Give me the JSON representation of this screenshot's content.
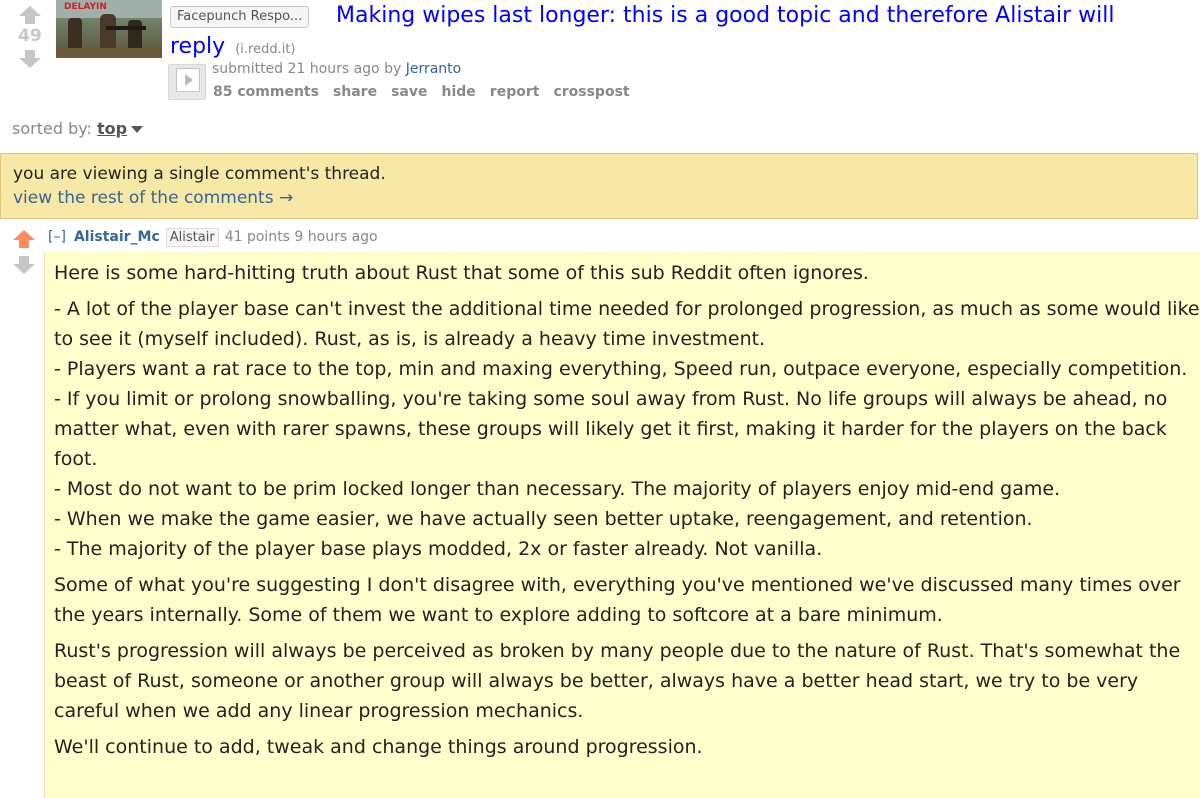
{
  "post": {
    "score": "49",
    "flair": "Facepunch Respo...",
    "title": "Making wipes last longer: this is a good topic and therefore Alistair will reply",
    "domain": "(i.redd.it)",
    "thumbnail_text": "DELAYIN",
    "submitted_prefix": "submitted 21 hours ago by",
    "author": "Jerranto",
    "buttons": {
      "comments": "85 comments",
      "share": "share",
      "save": "save",
      "hide": "hide",
      "report": "report",
      "crosspost": "crosspost"
    }
  },
  "sort": {
    "label": "sorted by:",
    "value": "top"
  },
  "notice": {
    "line1": "you are viewing a single comment's thread.",
    "line2": "view the rest of the comments →"
  },
  "comment": {
    "expand": "[–]",
    "author": "Alistair_Mc",
    "flair": "Alistair",
    "meta": "41 points 9 hours ago",
    "intro": "Here is some hard-hitting truth about Rust that some of this sub Reddit often ignores.",
    "bullets": [
      "- A lot of the player base can't invest the additional time needed for prolonged progression, as much as some would like to see it (myself included). Rust, as is, is already a heavy time investment.",
      "- Players want a rat race to the top, min and maxing everything, Speed run, outpace everyone, especially competition.",
      "- If you limit or prolong snowballing, you're taking some soul away from Rust. No life groups will always be ahead, no matter what, even with rarer spawns, these groups will likely get it first, making it harder for the players on the back foot.",
      "- Most do not want to be prim locked longer than necessary. The majority of players enjoy mid-end game.",
      "- When we make the game easier, we have actually seen better uptake, reengagement, and retention.",
      "- The majority of the player base plays modded, 2x or faster already. Not vanilla."
    ],
    "para2": "Some of what you're suggesting I don't disagree with, everything you've mentioned we've discussed many times over the years internally. Some of them we want to explore adding to softcore at a bare minimum.",
    "para3": "Rust's progression will always be perceived as broken by many people due to the nature of Rust. That's somewhat the beast of Rust, someone or another group will always be better, always have a better head start, we try to be very careful when we add any linear progression mechanics.",
    "para4": "We'll continue to add, tweak and change things around progression."
  },
  "colors": {
    "link_blue": "#0000ff",
    "author_blue": "#336699",
    "upvoted_orange": "#ff8b60",
    "notice_bg": "#f7e8a5",
    "comment_bg": "#ffffcc"
  }
}
